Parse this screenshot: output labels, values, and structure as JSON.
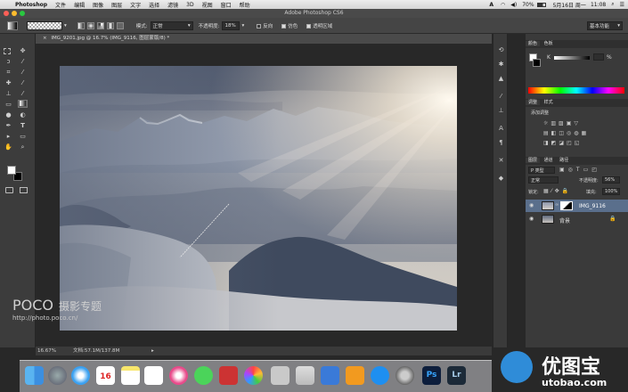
{
  "menubar": {
    "app_name": "Photoshop",
    "menus": [
      "文件",
      "编辑",
      "图像",
      "图层",
      "文字",
      "选择",
      "滤镜",
      "3D",
      "视图",
      "窗口",
      "帮助"
    ],
    "battery": "70%",
    "date": "5月16日 周一",
    "time": "11:08"
  },
  "window": {
    "title": "Adobe Photoshop CS6"
  },
  "options": {
    "mode_label": "模式:",
    "mode_value": "正常",
    "opacity_label": "不透明度:",
    "opacity_value": "18%",
    "reverse_label": "反向",
    "dither_label": "仿色",
    "transparency_label": "透明区域",
    "workspace": "基本功能"
  },
  "document": {
    "tab_title": "IMG_9201.jpg @ 16.7% (IMG_9116, 图层蒙版/8) *",
    "zoom": "16.67%",
    "doc_info": "文档:57.1M/137.8M"
  },
  "watermark": {
    "brand": "POCO",
    "brand_sub": "摄影专题",
    "url": "http://photo.poco.cn/"
  },
  "color_panel": {
    "tabs": [
      "颜色",
      "色板"
    ],
    "channel": "K",
    "value": "%"
  },
  "adjust_panel": {
    "tabs": [
      "调整",
      "样式"
    ],
    "add_label": "添加调整"
  },
  "layers_panel": {
    "tabs": [
      "图层",
      "通道",
      "路径"
    ],
    "kind_label": "P 类型",
    "blend_mode": "正常",
    "opacity_label": "不透明度:",
    "opacity_value": "56%",
    "lock_label": "锁定:",
    "fill_label": "填充:",
    "fill_value": "100%",
    "layers": [
      {
        "name": "IMG_9116"
      },
      {
        "name": "背景"
      }
    ]
  },
  "logo": {
    "name": "优图宝",
    "domain": "utobao.com"
  },
  "colors": {
    "menubar": "#dedede",
    "panel": "#3a3a3a",
    "canvas": "#282828",
    "accent": "#2f8cd8"
  }
}
